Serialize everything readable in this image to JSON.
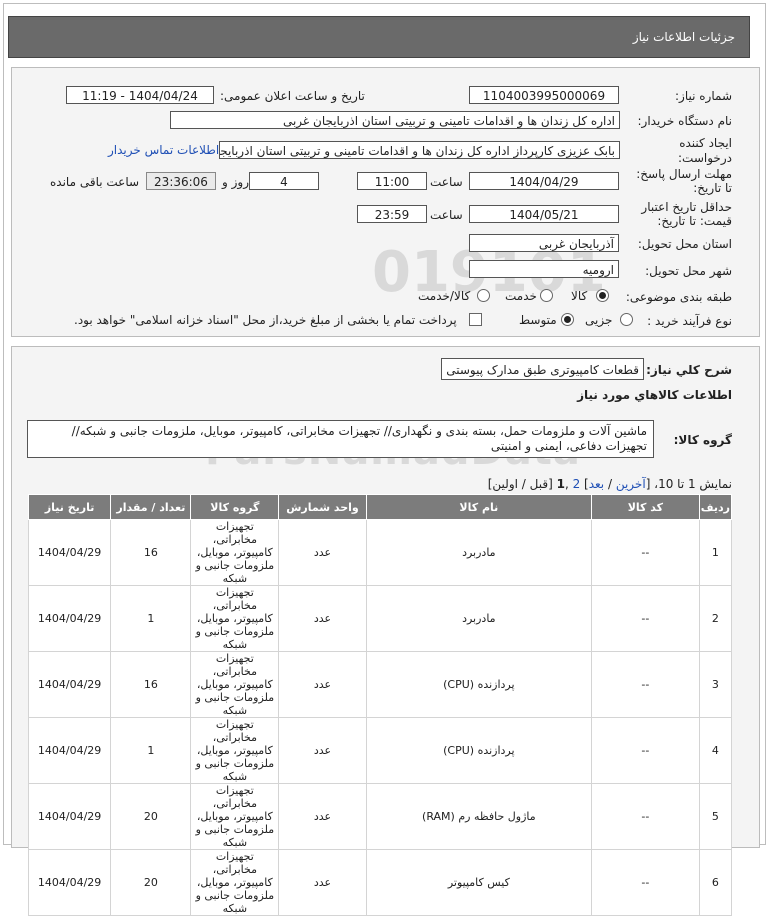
{
  "page_title": "جزئیات اطلاعات نیاز",
  "fields": {
    "need_number_label": "شماره نیاز:",
    "need_number": "1104003995000069",
    "announce_label": "تاریخ و ساعت اعلان عمومی:",
    "announce_value": "1404/04/24 - 11:19",
    "buyer_org_label": "نام دستگاه خریدار:",
    "buyer_org": "اداره کل زندان ها و اقدامات تامینی و تربیتی استان اذربایجان غربی",
    "creator_label_1": "ایجاد کننده",
    "creator_label_2": "درخواست:",
    "creator": "بابک عزیزی کارپرداز اداره کل زندان ها و اقدامات تامینی و تربیتی استان اذربایجان",
    "buyer_contact_link": "اطلاعات تماس خریدار",
    "reply_deadline_label_1": "مهلت ارسال پاسخ:",
    "reply_deadline_label_2": "تا تاریخ:",
    "reply_date": "1404/04/29",
    "time_label": "ساعت",
    "reply_time": "11:00",
    "days_value": "4",
    "days_label": "روز و",
    "remaining_time": "23:36:06",
    "remaining_label": "ساعت باقی مانده",
    "price_validity_label_1": "حداقل تاریخ اعتبار",
    "price_validity_label_2": "قیمت: تا تاریخ:",
    "validity_date": "1404/05/21",
    "validity_time": "23:59",
    "province_label": "استان محل تحویل:",
    "province": "آذربایجان غربی",
    "city_label": "شهر محل تحویل:",
    "city": "ارومیه",
    "category_label": "طبقه بندی موضوعی:",
    "category_options": [
      "کالا",
      "خدمت",
      "کالا/خدمت"
    ],
    "process_label": "نوع فرآیند خرید :",
    "process_options": [
      "جزیی",
      "متوسط"
    ],
    "payment_note": "پرداخت تمام یا بخشی از مبلغ خرید،از محل \"اسناد خزانه اسلامی\" خواهد بود."
  },
  "details": {
    "summary_label": "شرح کلي نياز:",
    "summary": "قطعات کامپیوتری طبق مدارک پیوستی",
    "goods_info_title": "اطلاعات کالاهاي مورد نياز",
    "goods_group_label": "گروه کالا:",
    "goods_group_line1": "ماشین آلات و ملزومات حمل، بسته بندی و نگهداری// تجهیزات مخابراتی، کامپیوتر، موبایل، ملزومات جانبی و شبکه//",
    "goods_group_line2": "تجهیزات دفاعی، ایمنی و امنیتی",
    "pagination": {
      "prefix": "نمایش 1 تا 10، [",
      "last": "آخرین",
      "sep1": " / ",
      "next": "بعد",
      "mid": "] ",
      "page2": "2",
      "comma": " ,",
      "page1": "1",
      "suffix": " [قبل / اولین]"
    }
  },
  "table": {
    "headers": {
      "row": "ردیف",
      "code": "کد کالا",
      "name": "نام کالا",
      "unit": "واحد شمارش",
      "group": "گروه کالا",
      "qty": "تعداد / مقدار",
      "date": "تاریخ نیاز"
    },
    "group_text": "تجهیزات مخابراتی، کامپیوتر، موبایل، ملزومات جانبی و شبکه",
    "rows": [
      {
        "row": "1",
        "code": "--",
        "name": "مادربرد",
        "unit": "عدد",
        "qty": "16",
        "date": "1404/04/29"
      },
      {
        "row": "2",
        "code": "--",
        "name": "مادربرد",
        "unit": "عدد",
        "qty": "1",
        "date": "1404/04/29"
      },
      {
        "row": "3",
        "code": "--",
        "name": "پردازنده (CPU)",
        "unit": "عدد",
        "qty": "16",
        "date": "1404/04/29"
      },
      {
        "row": "4",
        "code": "--",
        "name": "پردازنده (CPU)",
        "unit": "عدد",
        "qty": "1",
        "date": "1404/04/29"
      },
      {
        "row": "5",
        "code": "--",
        "name": "ماژول حافظه رم (RAM)",
        "unit": "عدد",
        "qty": "20",
        "date": "1404/04/29"
      },
      {
        "row": "6",
        "code": "--",
        "name": "کیس کامپیوتر",
        "unit": "عدد",
        "qty": "20",
        "date": "1404/04/29"
      }
    ]
  },
  "watermark": {
    "number": "019101",
    "brand": "ParsNamadData",
    "line1": "پایگاه اطلاع رسانی مناقصه",
    "phone": "۰۲۱-۸۸۳۴۹۶۷۰-۵"
  }
}
